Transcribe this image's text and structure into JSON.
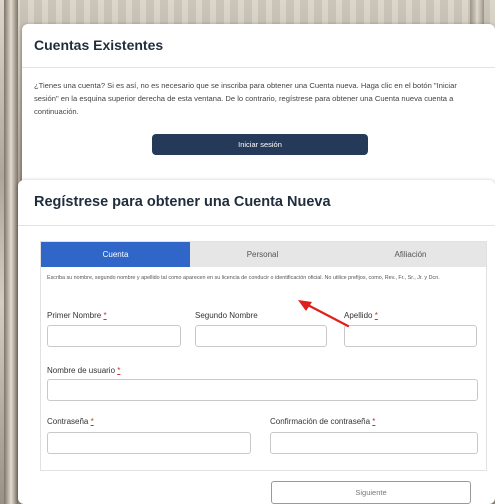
{
  "existing": {
    "title": "Cuentas Existentes",
    "description": "¿Tienes una cuenta? Si es así, no es necesario que se inscriba para obtener una Cuenta nueva. Haga clic en el botón \"Iniciar sesión\" en la esquina superior derecha de esta ventana. De lo contrario, regístrese para obtener una Cuenta nueva cuenta a continuación.",
    "login_label": "Iniciar sesión"
  },
  "register": {
    "title": "Regístrese para obtener una Cuenta Nueva",
    "tabs": [
      {
        "label": "Cuenta",
        "active": true
      },
      {
        "label": "Personal",
        "active": false
      },
      {
        "label": "Afiliación",
        "active": false
      }
    ],
    "help": "Escriba su nombre, segundo nombre y apellido tal como aparecen en su licencia de conducir o identificación oficial. No utilice prefijos, como, Rev., Fr., Sr., Jr. y Dcn.",
    "fields": {
      "first_name": "Primer Nombre",
      "middle_name": "Segundo Nombre",
      "last_name": "Apellido",
      "username": "Nombre de usuario",
      "password": "Contraseña",
      "confirm_password": "Confirmación de contraseña"
    },
    "required_mark": "*",
    "next_label": "Siguiente"
  },
  "colors": {
    "active_tab": "#2f66c8",
    "login_button": "#253a58",
    "annotation_arrow": "#e0201b"
  }
}
